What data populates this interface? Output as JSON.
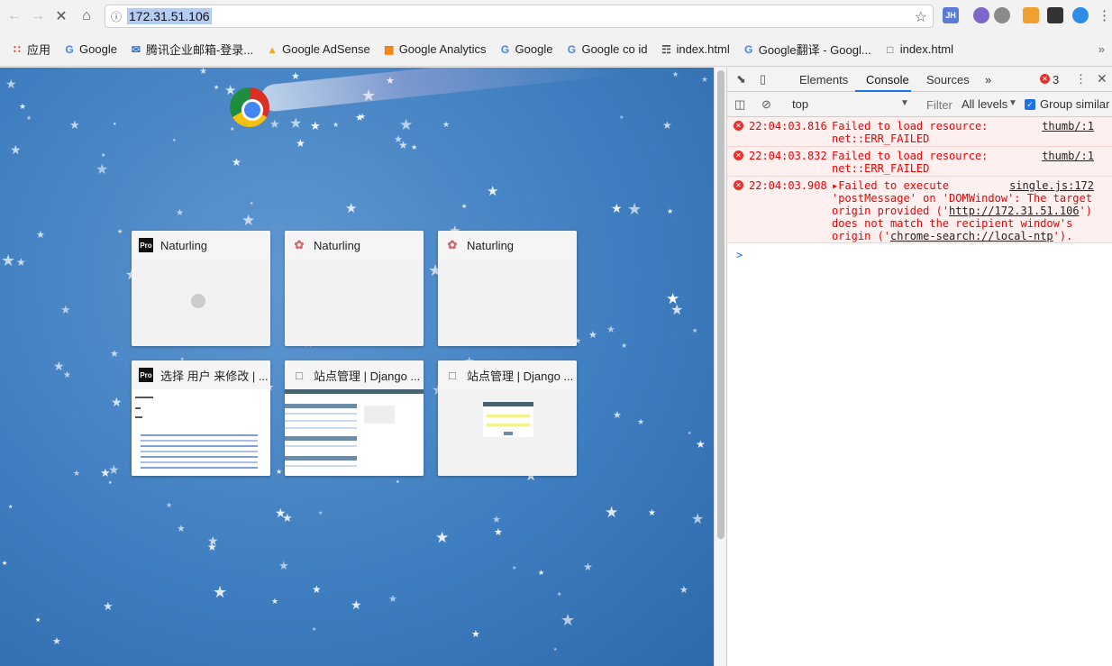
{
  "toolbar": {
    "back_icon": "arrow-left-icon",
    "forward_icon": "arrow-right-icon",
    "stop_icon": "close-icon",
    "home_icon": "home-icon",
    "url": "172.31.51.106"
  },
  "extensions": [
    "JH"
  ],
  "bookmarks": [
    {
      "label": "应用",
      "icon": "apps-grid-icon"
    },
    {
      "label": "Google",
      "icon": "google-icon"
    },
    {
      "label": "腾讯企业邮箱-登录...",
      "icon": "mail-icon"
    },
    {
      "label": "Google AdSense",
      "icon": "adsense-icon"
    },
    {
      "label": "Google Analytics",
      "icon": "analytics-icon"
    },
    {
      "label": "Google",
      "icon": "google-icon"
    },
    {
      "label": "Google co id",
      "icon": "google-icon"
    },
    {
      "label": "index.html",
      "icon": "book-icon"
    },
    {
      "label": "Google翻译 - Googl...",
      "icon": "google-icon"
    },
    {
      "label": "index.html",
      "icon": "document-icon"
    }
  ],
  "tiles": [
    {
      "title": "Naturling",
      "favicon": "Pro"
    },
    {
      "title": "Naturling",
      "favicon": "rose-icon"
    },
    {
      "title": "Naturling",
      "favicon": "rose-icon"
    },
    {
      "title": "选择 用户 来修改 | ...",
      "favicon": "Pro"
    },
    {
      "title": "站点管理 | Django ...",
      "favicon": "document-icon"
    },
    {
      "title": "站点管理 | Django ...",
      "favicon": "document-icon"
    }
  ],
  "devtools": {
    "tabs": [
      "Elements",
      "Console",
      "Sources"
    ],
    "active_tab": "Console",
    "more_tabs": "»",
    "error_count": "3",
    "context": "top",
    "filter_placeholder": "Filter",
    "levels": "All levels",
    "group_similar": "Group similar",
    "messages": [
      {
        "time": "22:04:03.816",
        "text": "Failed to load resource:\nnet::ERR_FAILED",
        "source": "thumb/:1"
      },
      {
        "time": "22:04:03.832",
        "text": "Failed to load resource:\nnet::ERR_FAILED",
        "source": "thumb/:1"
      },
      {
        "time": "22:04:03.908",
        "text_prefix": "▸Failed to execute\n'postMessage' on 'DOMWindow': The target\norigin provided ('",
        "link1": "http://172.31.51.106",
        "text_mid": "')\ndoes not match the recipient window's\norigin ('",
        "link2": "chrome-search://local-ntp",
        "text_suffix": "').",
        "source": "single.js:172"
      }
    ],
    "prompt": ">"
  }
}
